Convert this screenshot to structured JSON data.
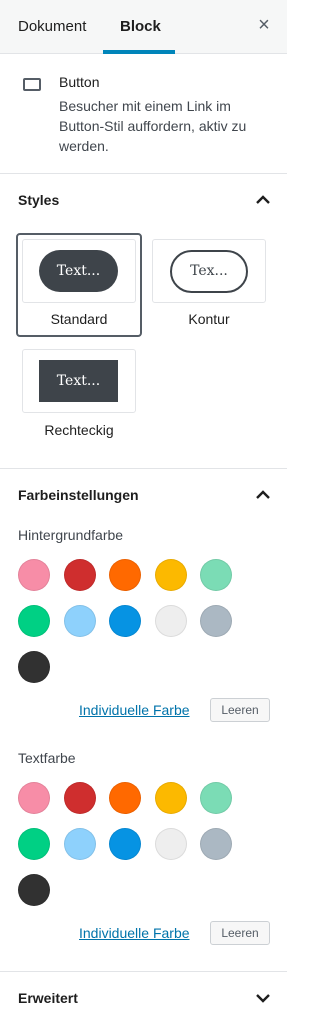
{
  "tabs": {
    "document": "Dokument",
    "block": "Block"
  },
  "close_label": "×",
  "block_card": {
    "title": "Button",
    "description": "Besucher mit einem Link im Button-Stil auffordern, aktiv zu werden.",
    "icon": "button-block-icon"
  },
  "styles_panel": {
    "title": "Styles",
    "expanded": true,
    "items": [
      {
        "label": "Standard",
        "preview": "Text...",
        "selected": true
      },
      {
        "label": "Kontur",
        "preview": "Tex...",
        "selected": false
      },
      {
        "label": "Rechteckig",
        "preview": "Text...",
        "selected": false
      }
    ]
  },
  "color_panel": {
    "title": "Farbeinstellungen",
    "expanded": true,
    "background": {
      "label": "Hintergrundfarbe",
      "custom_link": "Individuelle Farbe",
      "clear": "Leeren",
      "swatches": [
        "#f78da7",
        "#cf2e2e",
        "#ff6900",
        "#fcb900",
        "#7bdcb5",
        "#00d084",
        "#8ed1fc",
        "#0693e3",
        "#eeeeee",
        "#abb8c3",
        "#313131"
      ]
    },
    "text": {
      "label": "Textfarbe",
      "custom_link": "Individuelle Farbe",
      "clear": "Leeren",
      "swatches": [
        "#f78da7",
        "#cf2e2e",
        "#ff6900",
        "#fcb900",
        "#7bdcb5",
        "#00d084",
        "#8ed1fc",
        "#0693e3",
        "#eeeeee",
        "#abb8c3",
        "#313131"
      ]
    }
  },
  "advanced_panel": {
    "title": "Erweitert",
    "expanded": false
  },
  "colors": {
    "accent": "#0085ba",
    "link": "#0073aa",
    "dark": "#3e444a"
  }
}
